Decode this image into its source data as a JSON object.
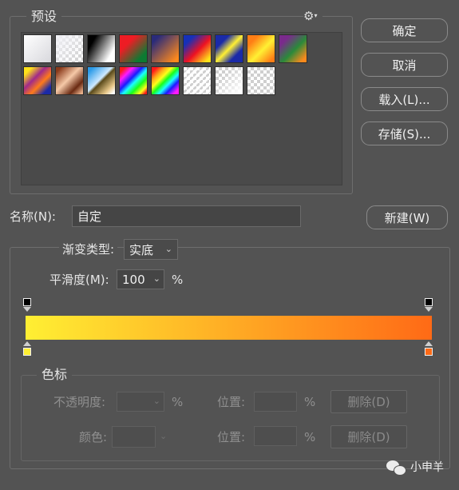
{
  "presets": {
    "legend": "预设",
    "gear_icon": "gear-icon"
  },
  "buttons": {
    "ok": "确定",
    "cancel": "取消",
    "load": "载入(L)...",
    "save": "存储(S)...",
    "new": "新建(W)"
  },
  "name_field": {
    "label": "名称(N):",
    "value": "自定"
  },
  "gradient": {
    "type_label": "渐变类型:",
    "type_value": "实底",
    "smoothness_label": "平滑度(M):",
    "smoothness_value": "100",
    "percent": "%",
    "start_color": "#ffef33",
    "end_color": "#ff6a16"
  },
  "stops": {
    "legend": "色标",
    "opacity_label": "不透明度:",
    "percent_1": "%",
    "location_label_1": "位置:",
    "percent_2": "%",
    "delete_1": "删除(D)",
    "color_label": "颜色:",
    "location_label_2": "位置:",
    "percent_3": "%",
    "delete_2": "删除(D)"
  },
  "watermark": {
    "text": "小申羊"
  }
}
